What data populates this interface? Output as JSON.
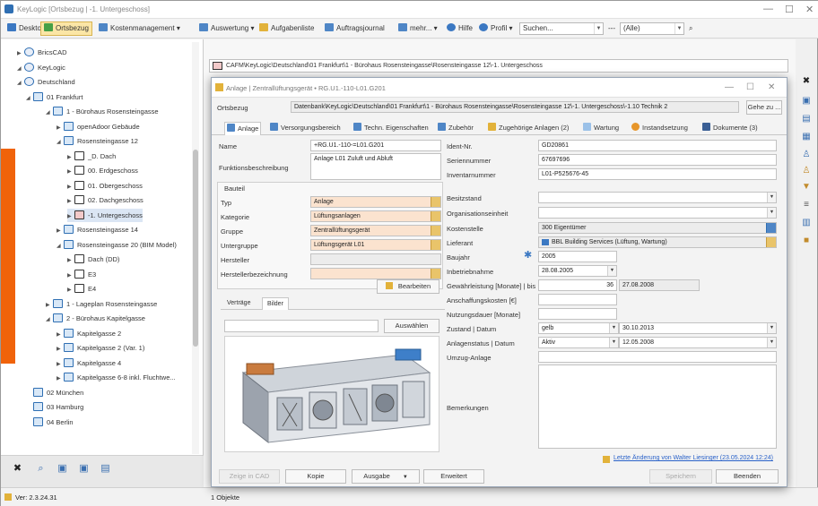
{
  "window": {
    "title": "KeyLogic [Ortsbezug | -1. Untergeschoss]"
  },
  "toolbar": {
    "desktop": "Desktop",
    "ortsbezug": "Ortsbezug",
    "kostenmanagement": "Kostenmanagement",
    "auswertung": "Auswertung",
    "aufgabenliste": "Aufgabenliste",
    "auftragsjournal": "Auftragsjournal",
    "mehr": "mehr...",
    "hilfe": "Hilfe",
    "profil": "Profil",
    "search_value": "Suchen...",
    "filter_value": "(Alle)"
  },
  "tree": [
    {
      "label": "BricsCAD",
      "level": 0
    },
    {
      "label": "KeyLogic",
      "level": 0
    },
    {
      "label": "Deutschland",
      "level": 1
    },
    {
      "label": "01 Frankfurt",
      "level": 2
    },
    {
      "label": "1 - Bürohaus Rosensteingasse",
      "level": 3
    },
    {
      "label": "openAdoor Gebäude",
      "level": 4
    },
    {
      "label": "Rosensteingasse 12",
      "level": 4
    },
    {
      "label": "_D. Dach",
      "level": 5
    },
    {
      "label": "00. Erdgeschoss",
      "level": 5
    },
    {
      "label": "01. Obergeschoss",
      "level": 5
    },
    {
      "label": "02. Dachgeschoss",
      "level": 5
    },
    {
      "label": "-1. Untergeschoss",
      "level": 5
    },
    {
      "label": "Rosensteingasse 14",
      "level": 4
    },
    {
      "label": "Rosensteingasse 20 (BIM Model)",
      "level": 4
    },
    {
      "label": "Dach (DD)",
      "level": 5
    },
    {
      "label": "E3",
      "level": 5
    },
    {
      "label": "E4",
      "level": 5
    },
    {
      "label": "1 - Lageplan Rosensteingasse",
      "level": 3
    },
    {
      "label": "2 - Bürohaus Kapitelgasse",
      "level": 3
    },
    {
      "label": "Kapitelgasse 2",
      "level": 4
    },
    {
      "label": "Kapitelgasse 2 (Var. 1)",
      "level": 4
    },
    {
      "label": "Kapitelgasse 4",
      "level": 4
    },
    {
      "label": "Kapitelgasse 6-8 inkl. Fluchtwe...",
      "level": 4
    },
    {
      "label": "02 München",
      "level": 2
    },
    {
      "label": "03 Hamburg",
      "level": 2
    },
    {
      "label": "04 Berlin",
      "level": 2
    }
  ],
  "status": {
    "version": "Ver: 2.3.24.31",
    "objects": "1 Objekte"
  },
  "path": "CAFM\\KeyLogic\\Deutschland\\01 Frankfurt\\1 - Bürohaus Rosensteingasse\\Rosensteingasse 12\\-1. Untergeschoss",
  "dialog": {
    "title": "Anlage | Zentrallüftungsgerät • RG.U1.-110-L01.G201",
    "ortsbezug_label": "Ortsbezug",
    "ortsbezug_value": "Datenbank\\KeyLogic\\Deutschland\\01 Frankfurt\\1 - Bürohaus Rosensteingasse\\Rosensteingasse 12\\-1. Untergeschoss\\-1.10 Technik 2",
    "goto_button": "Gehe zu ...",
    "tabs": [
      "Anlage",
      "Versorgungsbereich",
      "Techn. Eigenschaften",
      "Zubehör",
      "Zugehörige Anlagen (2)",
      "Wartung",
      "Instandsetzung",
      "Dokumente (3)"
    ],
    "left": {
      "name_label": "Name",
      "name_value": "+RG.U1.-110-=L01.G201",
      "funktion_label": "Funktionsbeschreibung",
      "funktion_value": "Anlage L01 Zuluft und Abluft",
      "bauteil_label": "Bauteil",
      "typ_label": "Typ",
      "typ_value": "Anlage",
      "kategorie_label": "Kategorie",
      "kategorie_value": "Lüftungsanlagen",
      "gruppe_label": "Gruppe",
      "gruppe_value": "Zentrallüftungsgerät",
      "untergruppe_label": "Untergruppe",
      "untergruppe_value": "Lüftungsgerät L01",
      "hersteller_label": "Hersteller",
      "hersteller_value": "",
      "herstellerbez_label": "Herstellerbezeichnung",
      "herstellerbez_value": "",
      "bearbeiten_button": "Bearbeiten",
      "subtabs": [
        "Verträge",
        "Bilder"
      ],
      "auswaehlen_button": "Auswählen"
    },
    "right": {
      "ident_label": "Ident-Nr.",
      "ident_value": "GD20861",
      "serie_label": "Seriennummer",
      "serie_value": "67697696",
      "inventar_label": "Inventarnummer",
      "inventar_value": "L01-P525676-45",
      "besitz_label": "Besitzstand",
      "org_label": "Organisationseinheit",
      "kosten_label": "Kostenstelle",
      "kosten_value": "300 Eigentümer",
      "lieferant_label": "Lieferant",
      "lieferant_value": "BBL Building Services (Lüftung, Wartung)",
      "baujahr_label": "Baujahr",
      "baujahr_value": "2005",
      "inbetrieb_label": "Inbetriebnahme",
      "inbetrieb_value": "28.08.2005",
      "gewaehr_label": "Gewährleistung [Monate] | bis",
      "gewaehr_months": "36",
      "gewaehr_date": "27.08.2008",
      "anschaff_label": "Anschaffungskosten [€]",
      "nutzung_label": "Nutzungsdauer [Monate]",
      "zustand_label": "Zustand | Datum",
      "zustand_value": "gelb",
      "zustand_date": "30.10.2013",
      "status_label": "Anlagenstatus | Datum",
      "status_value": "Aktiv",
      "status_date": "12.05.2008",
      "umzug_label": "Umzug-Anlage",
      "bemerk_label": "Bemerkungen"
    },
    "last_change": "Letzte Änderung von Walter Liesinger (23.05.2024 12:24)",
    "buttons": {
      "zeige_cad": "Zeige in CAD",
      "kopie": "Kopie",
      "ausgabe": "Ausgabe",
      "erweitert": "Erweitert",
      "speichern": "Speichern",
      "beenden": "Beenden"
    }
  },
  "colors": {
    "accent_orange": "#f0630a",
    "active_tab": "#fbe6a6",
    "required_field": "#fbe3cf",
    "link": "#2a62c9"
  }
}
